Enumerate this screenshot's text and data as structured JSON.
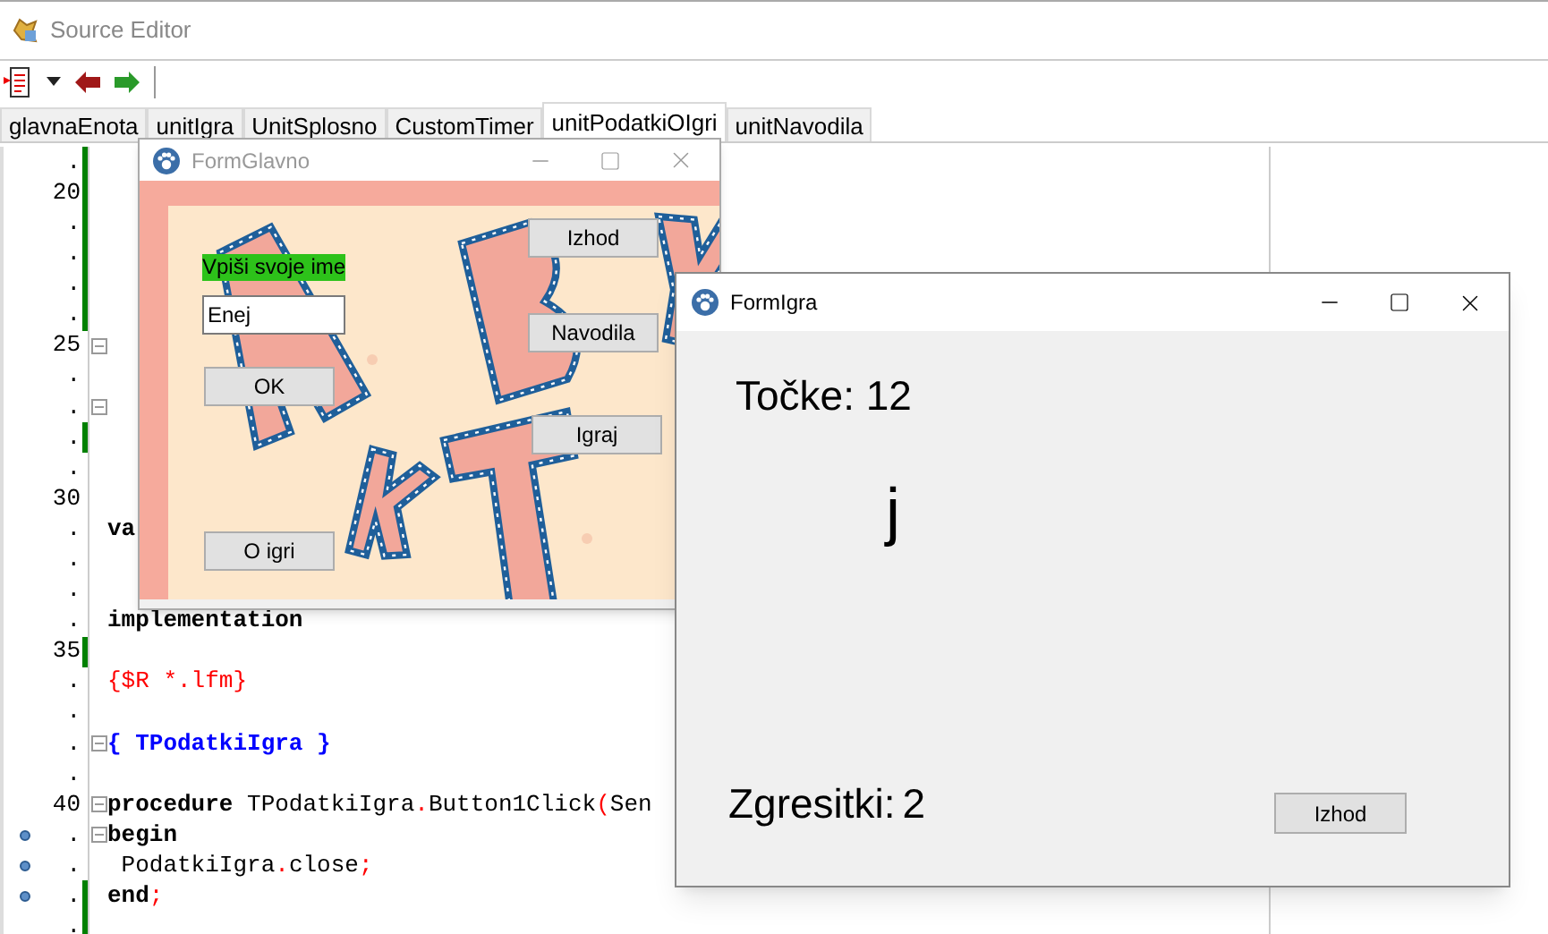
{
  "editor": {
    "title": "Source Editor",
    "tabs": [
      {
        "label": "glavnaEnota",
        "selected": false
      },
      {
        "label": "unitIgra",
        "selected": false
      },
      {
        "label": "UnitSplosno",
        "selected": false
      },
      {
        "label": "CustomTimer",
        "selected": false
      },
      {
        "label": "unitPodatkiOIgri",
        "selected": true
      },
      {
        "label": "unitNavodila",
        "selected": false
      }
    ],
    "lines": [
      {
        "number": ".",
        "changed": true,
        "bookmark": false,
        "fold": false
      },
      {
        "number": "20",
        "changed": true,
        "bookmark": false,
        "fold": false
      },
      {
        "number": ".",
        "changed": true,
        "bookmark": false,
        "fold": false
      },
      {
        "number": ".",
        "changed": true,
        "bookmark": false,
        "fold": false
      },
      {
        "number": ".",
        "changed": true,
        "bookmark": false,
        "fold": false
      },
      {
        "number": ".",
        "changed": true,
        "bookmark": false,
        "fold": false
      },
      {
        "number": "25",
        "changed": false,
        "bookmark": false,
        "fold": true
      },
      {
        "number": ".",
        "changed": false,
        "bookmark": false,
        "fold": false
      },
      {
        "number": ".",
        "changed": false,
        "bookmark": false,
        "fold": true
      },
      {
        "number": ".",
        "changed": true,
        "bookmark": false,
        "fold": false
      },
      {
        "number": ".",
        "changed": false,
        "bookmark": false,
        "fold": false
      },
      {
        "number": "30",
        "changed": false,
        "bookmark": false,
        "fold": false
      },
      {
        "number": ".",
        "changed": false,
        "bookmark": false,
        "fold": false,
        "tokens": [
          {
            "kind": "keyword",
            "text": "va"
          }
        ]
      },
      {
        "number": ".",
        "changed": false,
        "bookmark": false,
        "fold": false
      },
      {
        "number": ".",
        "changed": false,
        "bookmark": false,
        "fold": false
      },
      {
        "number": ".",
        "changed": false,
        "bookmark": false,
        "fold": false,
        "tokens": [
          {
            "kind": "keyword",
            "text": "implementation"
          }
        ]
      },
      {
        "number": "35",
        "changed": true,
        "bookmark": false,
        "fold": false
      },
      {
        "number": ".",
        "changed": false,
        "bookmark": false,
        "fold": false,
        "tokens": [
          {
            "kind": "directive",
            "text": "{$R *.lfm}"
          }
        ]
      },
      {
        "number": ".",
        "changed": false,
        "bookmark": false,
        "fold": false
      },
      {
        "number": ".",
        "changed": false,
        "bookmark": false,
        "fold": true,
        "tokens": [
          {
            "kind": "comment",
            "text": "{ TPodatkiIgra }"
          }
        ]
      },
      {
        "number": ".",
        "changed": false,
        "bookmark": false,
        "fold": false
      },
      {
        "number": "40",
        "changed": false,
        "bookmark": false,
        "fold": true,
        "tokens": [
          {
            "kind": "keyword",
            "text": "procedure"
          },
          {
            "kind": "plain",
            "text": " TPodatkiIgra"
          },
          {
            "kind": "symbol",
            "text": "."
          },
          {
            "kind": "plain",
            "text": "Button1Click"
          },
          {
            "kind": "symbol",
            "text": "("
          },
          {
            "kind": "plain",
            "text": "Sen"
          }
        ]
      },
      {
        "number": ".",
        "changed": false,
        "bookmark": true,
        "fold": true,
        "tokens": [
          {
            "kind": "keyword",
            "text": "begin"
          }
        ]
      },
      {
        "number": ".",
        "changed": false,
        "bookmark": true,
        "fold": false,
        "tokens": [
          {
            "kind": "plain",
            "text": " PodatkiIgra"
          },
          {
            "kind": "symbol",
            "text": "."
          },
          {
            "kind": "plain",
            "text": "close"
          },
          {
            "kind": "symbol",
            "text": ";"
          }
        ]
      },
      {
        "number": ".",
        "changed": true,
        "bookmark": true,
        "fold": false,
        "tokens": [
          {
            "kind": "keyword",
            "text": "end"
          },
          {
            "kind": "symbol",
            "text": ";"
          }
        ]
      },
      {
        "number": ".",
        "changed": true,
        "bookmark": false,
        "fold": false
      }
    ]
  },
  "form_glavno": {
    "title": "FormGlavno",
    "active": false,
    "name_label": "Vpiši svoje ime",
    "name_field": "Enej",
    "buttons": [
      {
        "kind": "ok",
        "label": "OK"
      },
      {
        "kind": "about",
        "label": "O igri"
      },
      {
        "kind": "exit",
        "label": "Izhod"
      },
      {
        "kind": "help",
        "label": "Navodila"
      },
      {
        "kind": "play",
        "label": "Igraj"
      }
    ]
  },
  "form_igra": {
    "title": "FormIgra",
    "active": true,
    "points": "Točke: 12",
    "letter": "j",
    "misses_label": "Zgresitki:",
    "misses_value": "2",
    "exit_button": "Izhod"
  }
}
